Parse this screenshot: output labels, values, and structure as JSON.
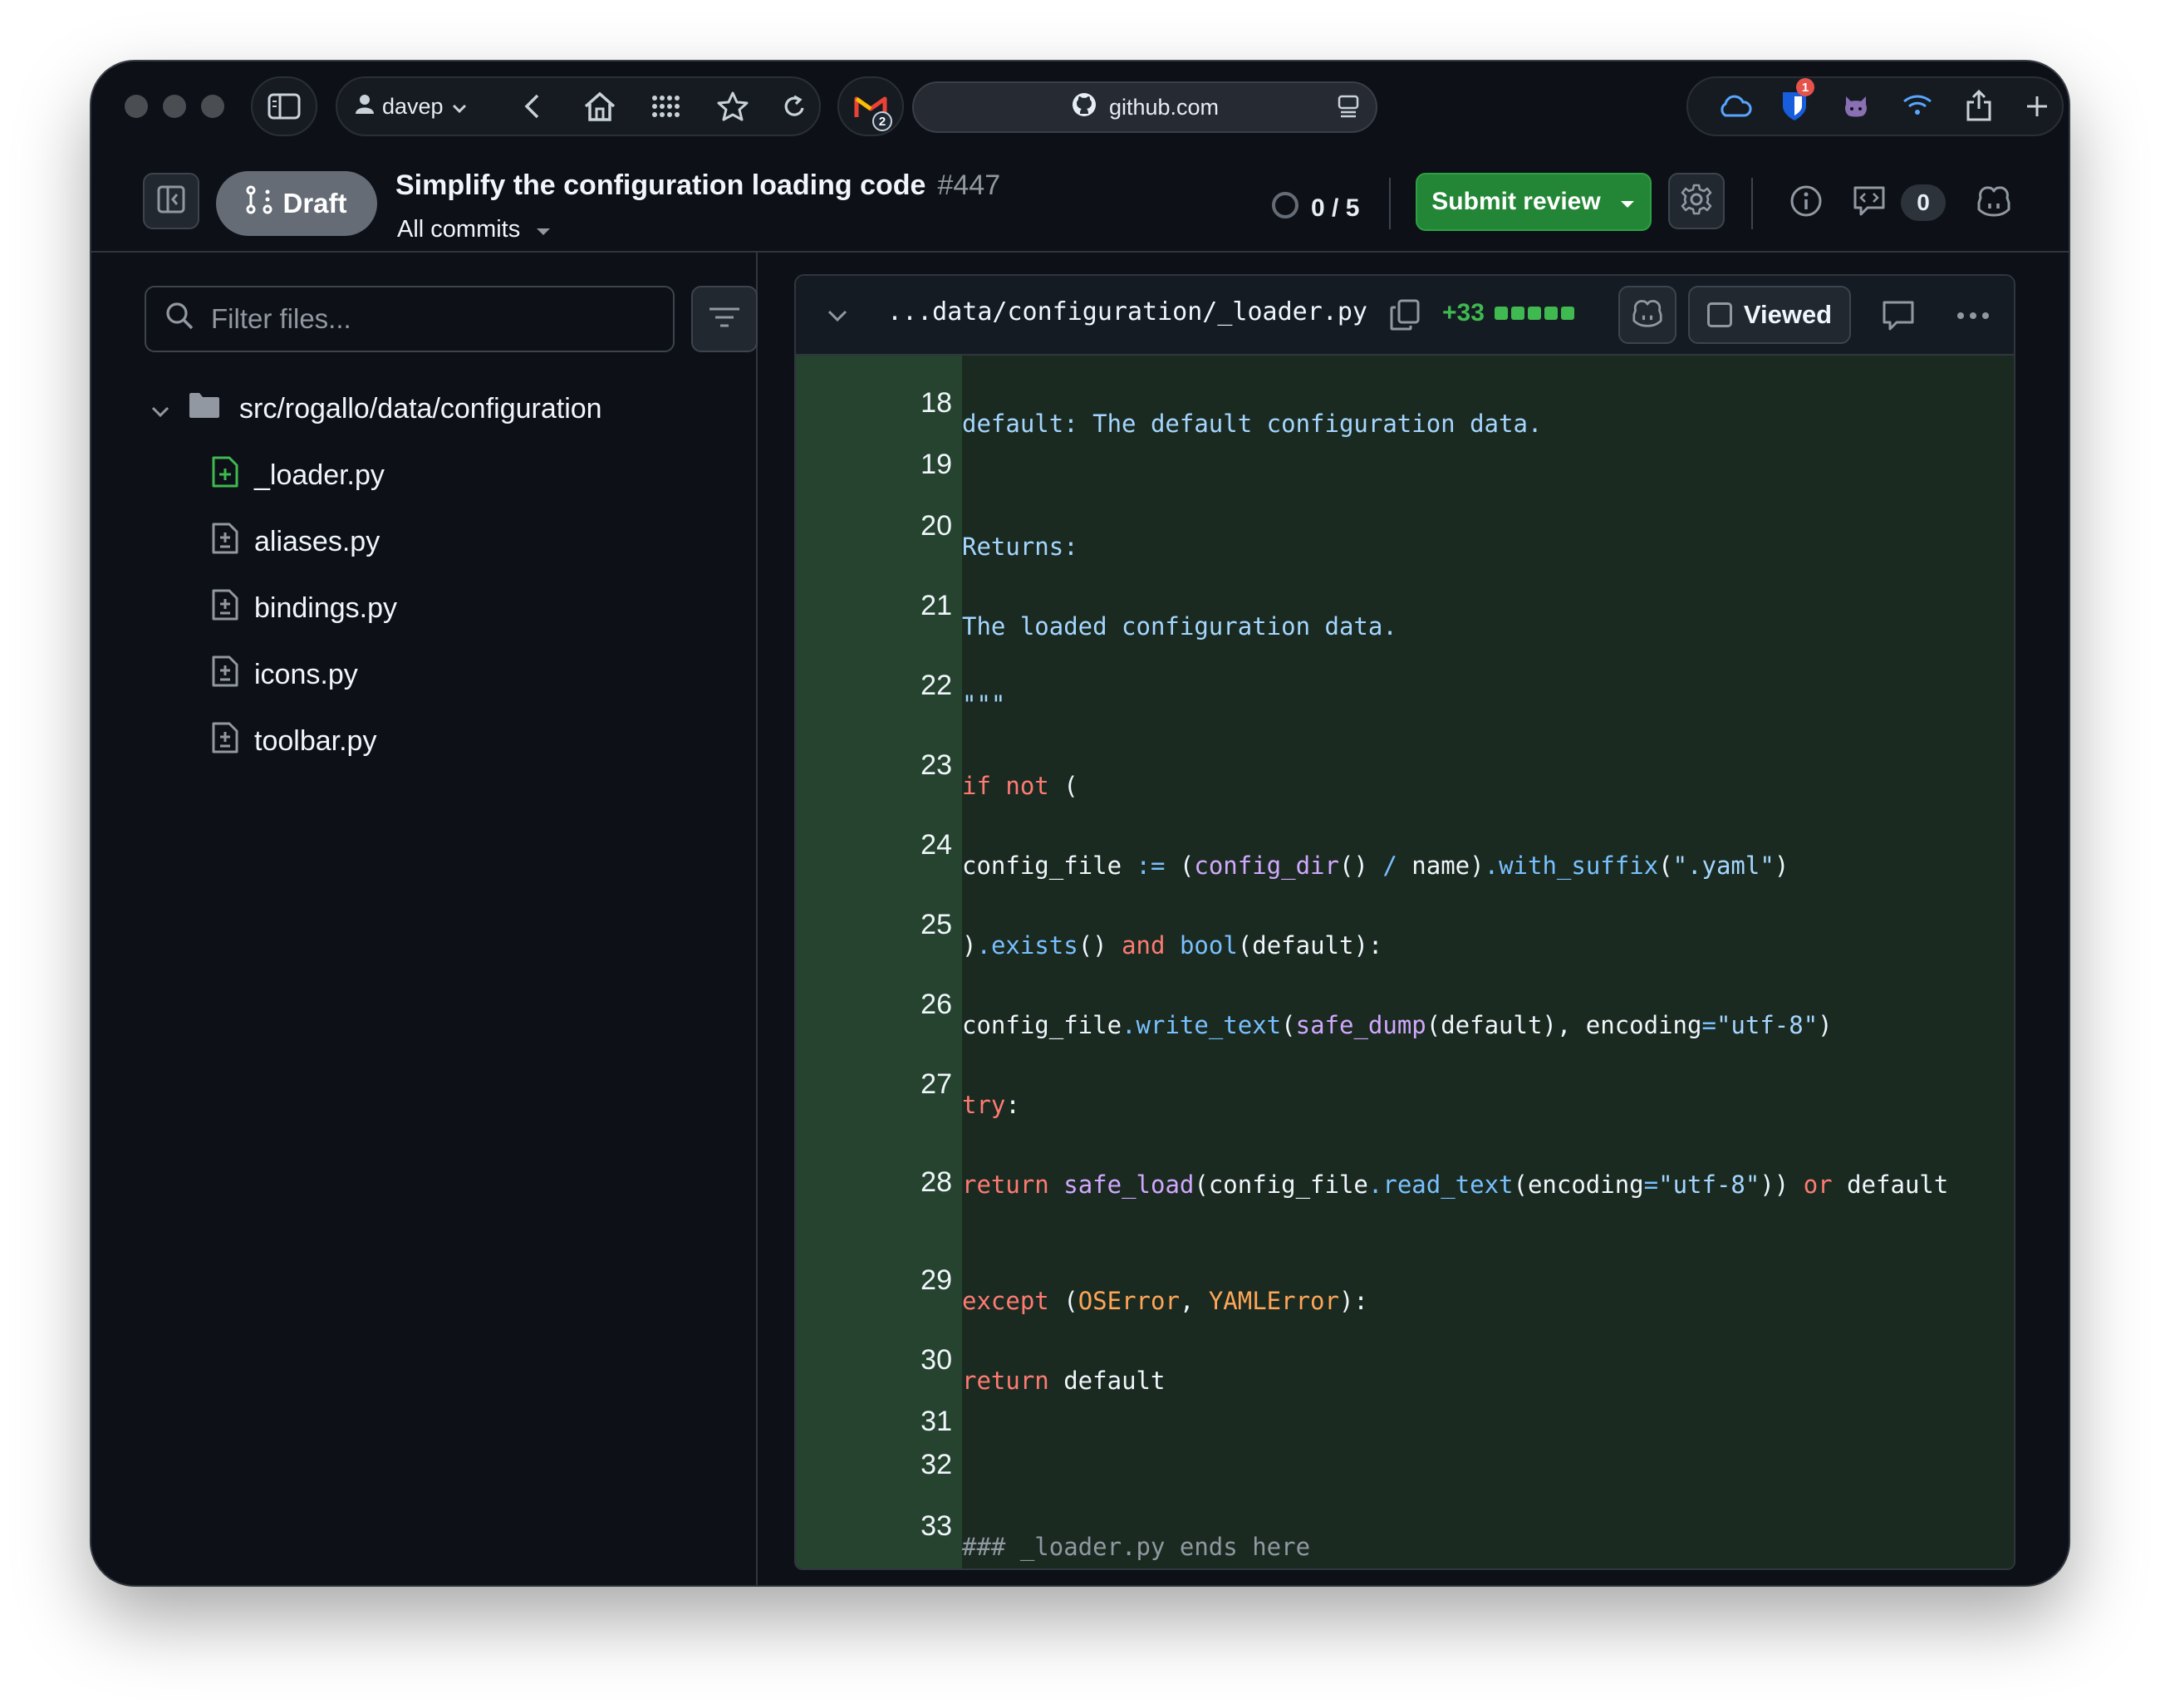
{
  "browser": {
    "profile_name": "davep",
    "url": "github.com",
    "extension_badge": "1",
    "gmail_badge": "2"
  },
  "pr": {
    "status": "Draft",
    "title": "Simplify the configuration loading code",
    "number": "#447",
    "commits_selector": "All commits",
    "progress": "0 / 5",
    "submit_label": "Submit review",
    "comment_count": "0"
  },
  "sidebar": {
    "filter_placeholder": "Filter files...",
    "directory": "src/rogallo/data/configuration",
    "files": [
      {
        "name": "_loader.py",
        "status": "added"
      },
      {
        "name": "aliases.py",
        "status": "modified"
      },
      {
        "name": "bindings.py",
        "status": "modified"
      },
      {
        "name": "icons.py",
        "status": "modified"
      },
      {
        "name": "toolbar.py",
        "status": "modified"
      }
    ]
  },
  "diff": {
    "file_path": "...data/configuration/_loader.py",
    "additions": "+33",
    "viewed_label": "Viewed",
    "lines": [
      {
        "num": "18",
        "text": "default: The default configuration data."
      },
      {
        "num": "19",
        "text": ""
      },
      {
        "num": "20",
        "text": "Returns:"
      },
      {
        "num": "21",
        "text": "The loaded configuration data."
      },
      {
        "num": "22",
        "text": "\"\"\""
      },
      {
        "num": "23",
        "text": "if not ("
      },
      {
        "num": "24",
        "text": "config_file := (config_dir() / name).with_suffix(\".yaml\")"
      },
      {
        "num": "25",
        "text": ").exists() and bool(default):"
      },
      {
        "num": "26",
        "text": "config_file.write_text(safe_dump(default), encoding=\"utf-8\")"
      },
      {
        "num": "27",
        "text": "try:"
      },
      {
        "num": "28",
        "text": "return safe_load(config_file.read_text(encoding=\"utf-8\")) or default"
      },
      {
        "num": "29",
        "text": "except (OSError, YAMLError):"
      },
      {
        "num": "30",
        "text": "return default"
      },
      {
        "num": "31",
        "text": ""
      },
      {
        "num": "32",
        "text": ""
      },
      {
        "num": "33",
        "text": "### _loader.py ends here"
      }
    ]
  },
  "colors": {
    "accent_green": "#238636",
    "added_gutter": "#26432f",
    "added_line": "#1a2a21",
    "background": "#0d1117"
  }
}
